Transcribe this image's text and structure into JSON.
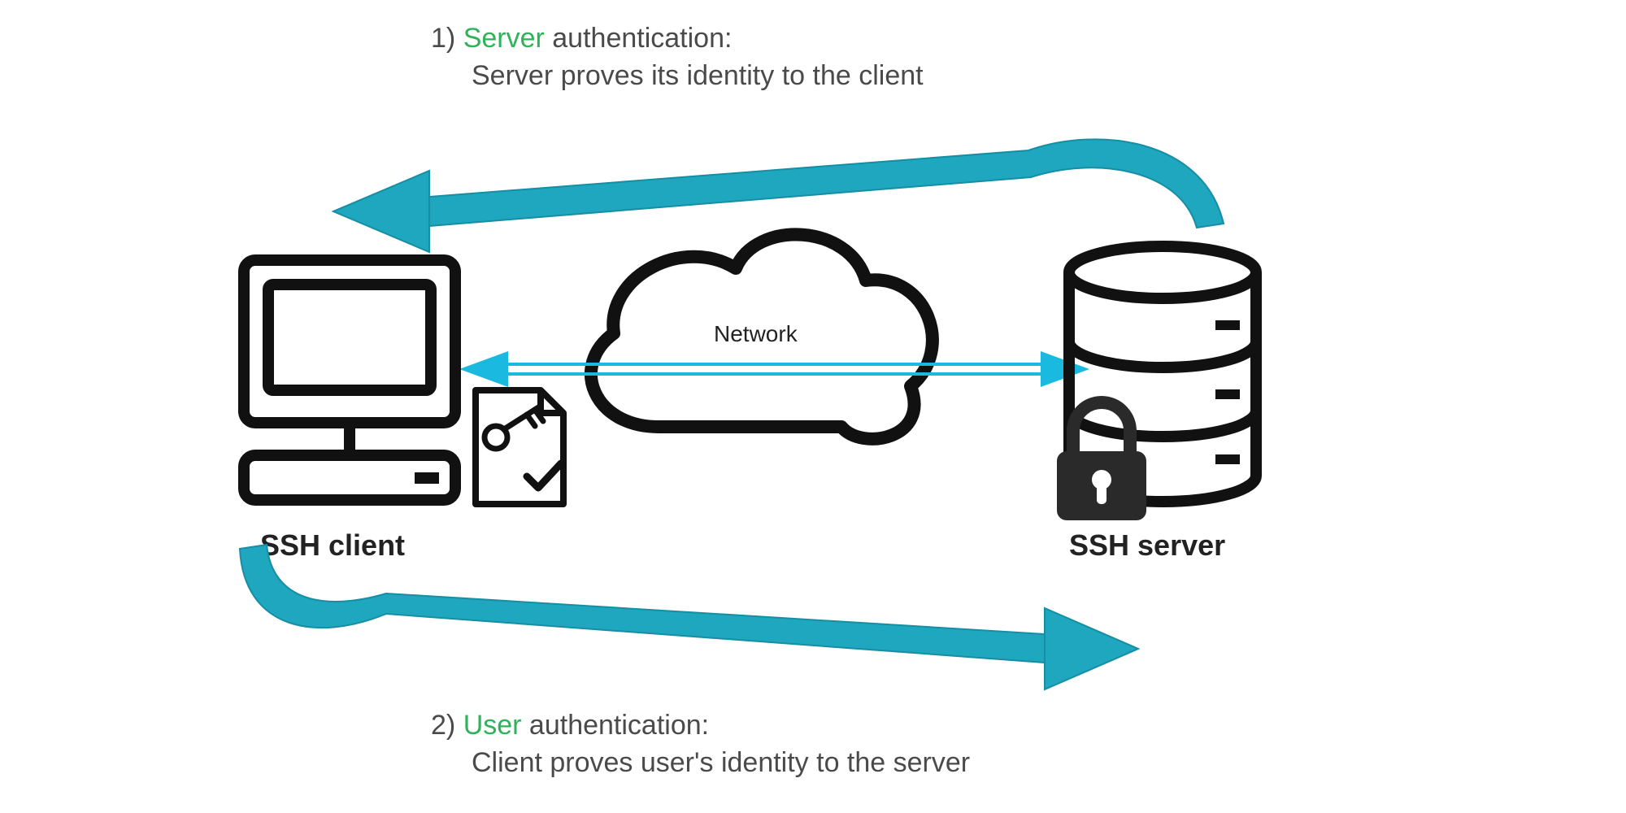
{
  "captions": {
    "top": {
      "num": "1) ",
      "hl": "Server",
      "rest1": " authentication:",
      "line2": "Server proves its identity to the client"
    },
    "bottom": {
      "num": "2) ",
      "hl": "User",
      "rest1": " authentication:",
      "line2": "Client proves user's identity to the server"
    }
  },
  "labels": {
    "client": "SSH client",
    "server": "SSH server",
    "network": "Network"
  },
  "colors": {
    "arrow": "#1ea7bf",
    "arrowDark": "#168ea3",
    "net": "#19b9e0",
    "text": "#4a4a4a",
    "hl": "#2eb35a",
    "lock": "#2a2a2a"
  }
}
